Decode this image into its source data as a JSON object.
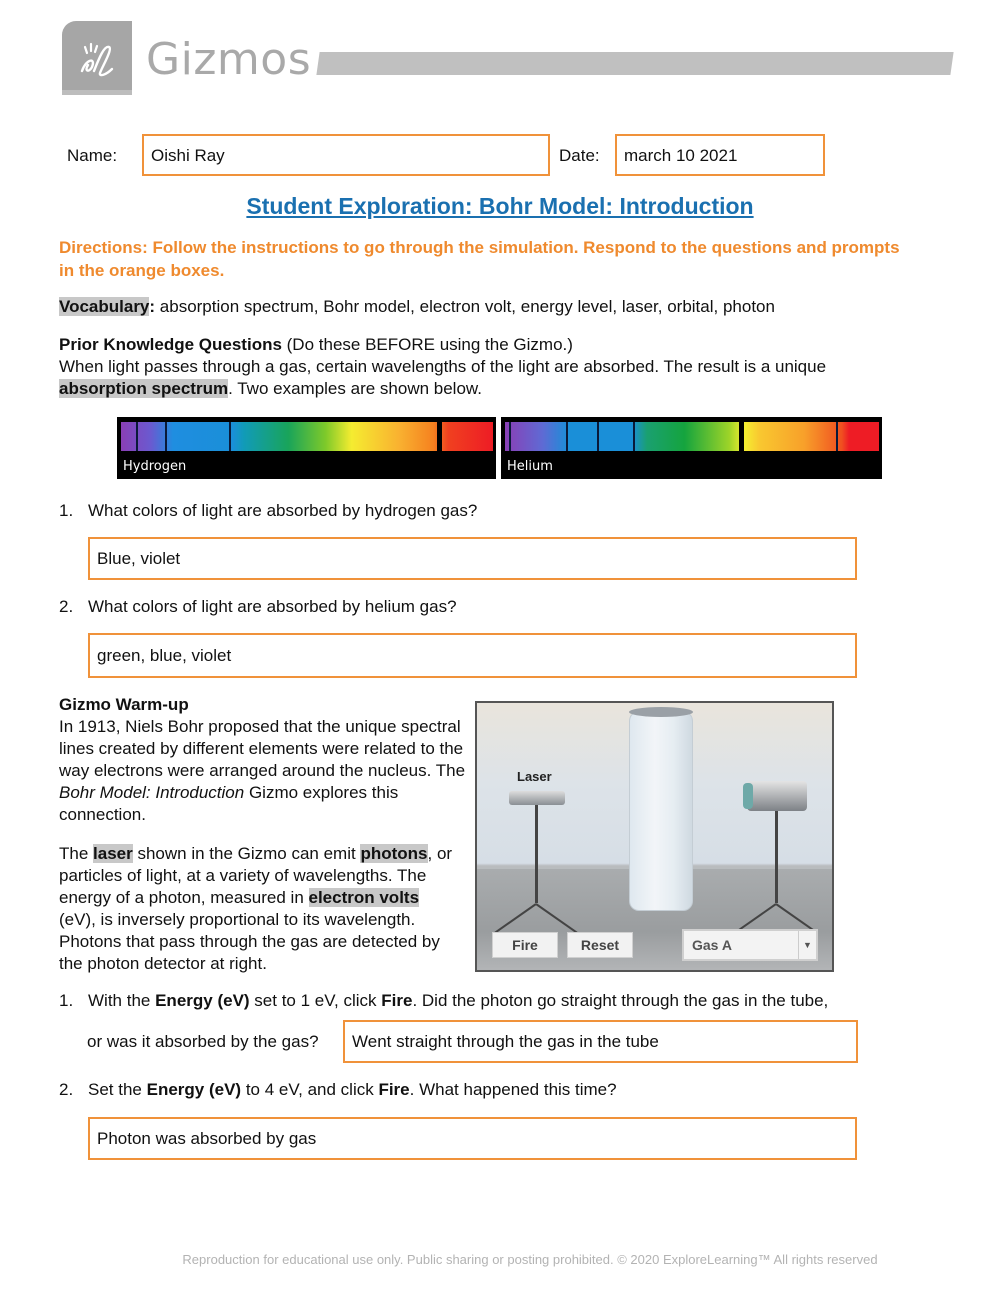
{
  "header": {
    "brand": "Gizmos",
    "logo_icon": "explorelearning-el-logo"
  },
  "form": {
    "name_label": "Name:",
    "name_value": "Oishi Ray",
    "date_label": "Date:",
    "date_value": "march 10 2021"
  },
  "title": "Student Exploration: Bohr Model: Introduction",
  "directions": "Directions: Follow the instructions to go through the simulation. Respond to the questions and prompts in the orange boxes.",
  "vocabulary": {
    "label": "Vocabulary",
    "colon": ":",
    "terms": " absorption spectrum, Bohr model, electron volt, energy level, laser, orbital, photon"
  },
  "prior_knowledge": {
    "heading": "Prior Knowledge Questions",
    "heading_note": " (Do these BEFORE using the Gizmo.)",
    "intro": "When light passes through a gas, certain wavelengths of the light are absorbed. The result is a unique",
    "term": "absorption spectrum",
    "intro_end": ". Two examples are shown below.",
    "spectra": [
      {
        "label": "Hydrogen"
      },
      {
        "label": "Helium"
      }
    ],
    "questions": [
      {
        "number": "1.",
        "text": "What colors of light are absorbed by hydrogen gas?",
        "answer": "Blue, violet"
      },
      {
        "number": "2.",
        "text": "What colors of light are absorbed by helium gas?",
        "answer": "green, blue, violet"
      }
    ]
  },
  "warmup": {
    "heading": "Gizmo Warm-up",
    "p1_a": "In 1913, Niels Bohr proposed that the unique spectral lines created by different elements were related to the way electrons were arranged around the nucleus. The ",
    "p1_italic": "Bohr Model: Introduction",
    "p1_b": " Gizmo explores this connection.",
    "p2": {
      "t1": "The ",
      "laser": "laser",
      "t2": " shown in the Gizmo can emit ",
      "photons": "photons",
      "t3": ", or particles of light, at a variety of wavelengths. The energy of a photon, measured in ",
      "ev": "electron volts",
      "t4": " (eV), is inversely proportional to its wavelength. Photons that pass through the gas are detected by the photon detector at right."
    },
    "gizmo": {
      "laser_label": "Laser",
      "fire_button": "Fire",
      "reset_button": "Reset",
      "gas_select": "Gas A"
    },
    "questions": [
      {
        "number": "1.",
        "t1": "With the ",
        "b1": "Energy (eV)",
        "t2": " set to 1 eV, click ",
        "b2": "Fire",
        "t3": ". Did the photon go straight through the gas in the tube,",
        "line2": "or was it absorbed by the gas?",
        "answer": "Went straight through the gas in the tube"
      },
      {
        "number": "2.",
        "t1": "Set the ",
        "b1": "Energy (eV)",
        "t2": " to 4 eV, and click ",
        "b2": "Fire",
        "t3": ". What happened this time?",
        "answer": "Photon was absorbed by gas"
      }
    ]
  },
  "footer": "Reproduction for educational use only. Public sharing or posting prohibited. © 2020 ExploreLearning™ All rights reserved",
  "colors": {
    "accent_orange": "#f0923a",
    "title_blue": "#1a70b0",
    "directions_orange": "#ef8a2e"
  }
}
